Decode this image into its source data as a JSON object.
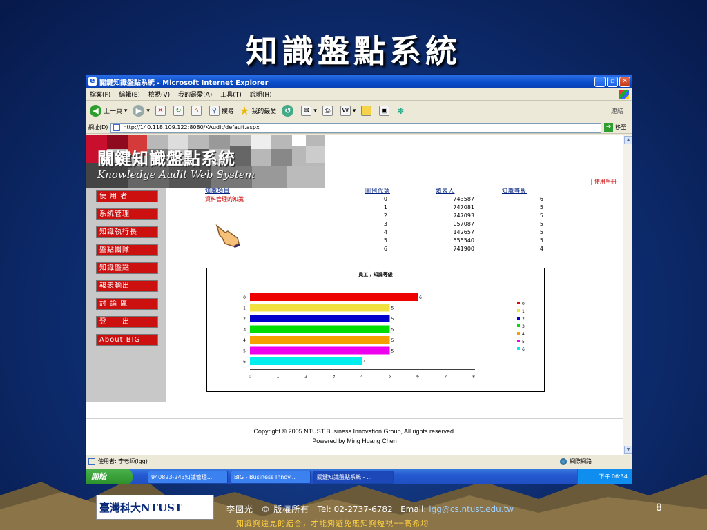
{
  "slide": {
    "title": "知識盤點系統",
    "page_number": "8"
  },
  "window": {
    "title": "關鍵知識盤點系統 - Microsoft Internet Explorer",
    "controls": {
      "minimize": "_",
      "restore": "▫",
      "close": "✕"
    }
  },
  "menu": {
    "items": [
      "檔案(F)",
      "編輯(E)",
      "檢視(V)",
      "我的最愛(A)",
      "工具(T)",
      "說明(H)"
    ]
  },
  "toolbar": {
    "back": "上一頁",
    "search": "搜尋",
    "favorites": "我的最愛",
    "links": "連結",
    "more": "»"
  },
  "address": {
    "label": "網址(D)",
    "url": "http://140.118.109.122:8080/KAudit/default.aspx",
    "go": "移至"
  },
  "banner": {
    "title": "關鍵知識盤點系統",
    "subtitle": "Knowledge Audit Web System",
    "manual_link": "| 使用手冊 |"
  },
  "nav": {
    "items": [
      "使 用 者",
      "系統管理",
      "知識執行長",
      "盤點團隊",
      "知識盤點",
      "報表輸出",
      "討 論 區",
      "登　　出",
      "About BIG"
    ]
  },
  "table": {
    "headers": [
      "知識項目",
      "圖例代號",
      "填表人",
      "知識等級"
    ],
    "item_name": "資料管理的知識",
    "rows": [
      {
        "code": "0",
        "filler": "743587",
        "level": "6"
      },
      {
        "code": "1",
        "filler": "747081",
        "level": "5"
      },
      {
        "code": "2",
        "filler": "747093",
        "level": "5"
      },
      {
        "code": "3",
        "filler": "057087",
        "level": "5"
      },
      {
        "code": "4",
        "filler": "142657",
        "level": "5"
      },
      {
        "code": "5",
        "filler": "555540",
        "level": "5"
      },
      {
        "code": "6",
        "filler": "741900",
        "level": "4"
      }
    ]
  },
  "chart_data": {
    "type": "bar",
    "orientation": "horizontal",
    "title": "員工 / 知識等級",
    "categories": [
      "0",
      "1",
      "2",
      "3",
      "4",
      "5",
      "6"
    ],
    "values": [
      6,
      5,
      5,
      5,
      5,
      5,
      4
    ],
    "colors": [
      "#ee0000",
      "#f0e040",
      "#0000cc",
      "#00dd00",
      "#f5a000",
      "#ee00ee",
      "#00eeee"
    ],
    "xlim": [
      0,
      8
    ],
    "xticks": [
      "0",
      "1",
      "2",
      "3",
      "4",
      "5",
      "6",
      "7",
      "8"
    ],
    "legend": [
      "0",
      "1",
      "2",
      "3",
      "4",
      "5",
      "6"
    ],
    "legend_position": "right"
  },
  "page_footer": {
    "line1": "Copyright © 2005 NTUST Business Innovation Group, All rights reserved.",
    "line2": "Powered by Ming Huang Chen"
  },
  "status": {
    "user": "使用者: 李老師(lgg)",
    "zone": "網際網路"
  },
  "taskbar": {
    "start": "開始",
    "tasks": [
      "940823-243知識管理...",
      "BIG - Business Innov...",
      "關鍵知識盤點系統 - ..."
    ],
    "clock": "下午 06:34"
  },
  "footer": {
    "logo": "臺灣科大NTUST",
    "author": "李國光",
    "rights": "© 版權所有",
    "tel": "Tel: 02-2737-6782",
    "email_label": "Email:",
    "email": "lgg@cs.ntust.edu.tw",
    "quote": "知識與遠見的結合，才能夠避免無知與短視──高希均"
  },
  "colors": {
    "nav_red": "#cc1010",
    "title_white": "#ffffff",
    "quote_yellow": "#ffd040"
  }
}
